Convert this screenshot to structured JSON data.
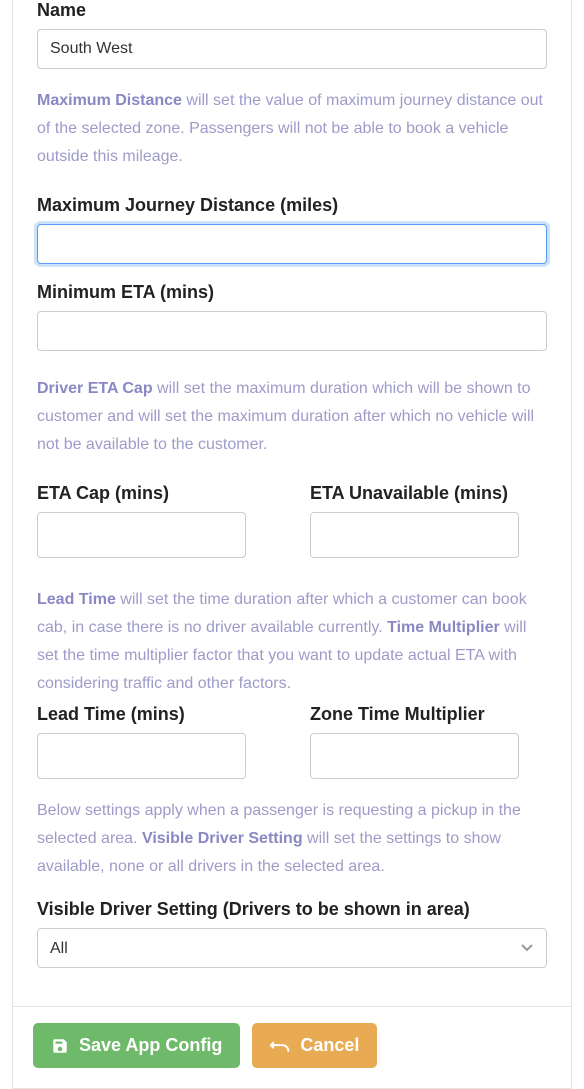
{
  "name": {
    "label": "Name",
    "value": "South West"
  },
  "help_max_distance": {
    "bold": "Maximum Distance",
    "text": " will set the value of maximum journey distance out of the selected zone. Passengers will not be able to book a vehicle outside this mileage."
  },
  "max_journey": {
    "label": "Maximum Journey Distance (miles)",
    "value": ""
  },
  "min_eta": {
    "label": "Minimum ETA (mins)",
    "value": ""
  },
  "help_eta_cap": {
    "bold": "Driver ETA Cap",
    "text": " will set the maximum duration which will be shown to customer and will set the maximum duration after which no vehicle will not be available to the customer."
  },
  "eta_cap": {
    "label": "ETA Cap (mins)",
    "value": ""
  },
  "eta_unavailable": {
    "label": "ETA Unavailable (mins)",
    "value": ""
  },
  "help_lead": {
    "bold1": "Lead Time",
    "text1": " will set the time duration after which a customer can book cab, in case there is no driver available currently. ",
    "bold2": "Time Multiplier",
    "text2": " will set the time multiplier factor that you want to update actual ETA with considering traffic and other factors."
  },
  "lead_time": {
    "label": "Lead Time (mins)",
    "value": ""
  },
  "zone_multiplier": {
    "label": "Zone Time Multiplier",
    "value": ""
  },
  "help_visible": {
    "text1": "Below settings apply when a passenger is requesting a pickup in the selected area. ",
    "bold": "Visible Driver Setting",
    "text2": " will set the settings to show available, none or all drivers in the selected area."
  },
  "visible_setting": {
    "label": "Visible Driver Setting (Drivers to be shown in area)",
    "value": "All"
  },
  "buttons": {
    "save": "Save App Config",
    "cancel": "Cancel"
  }
}
